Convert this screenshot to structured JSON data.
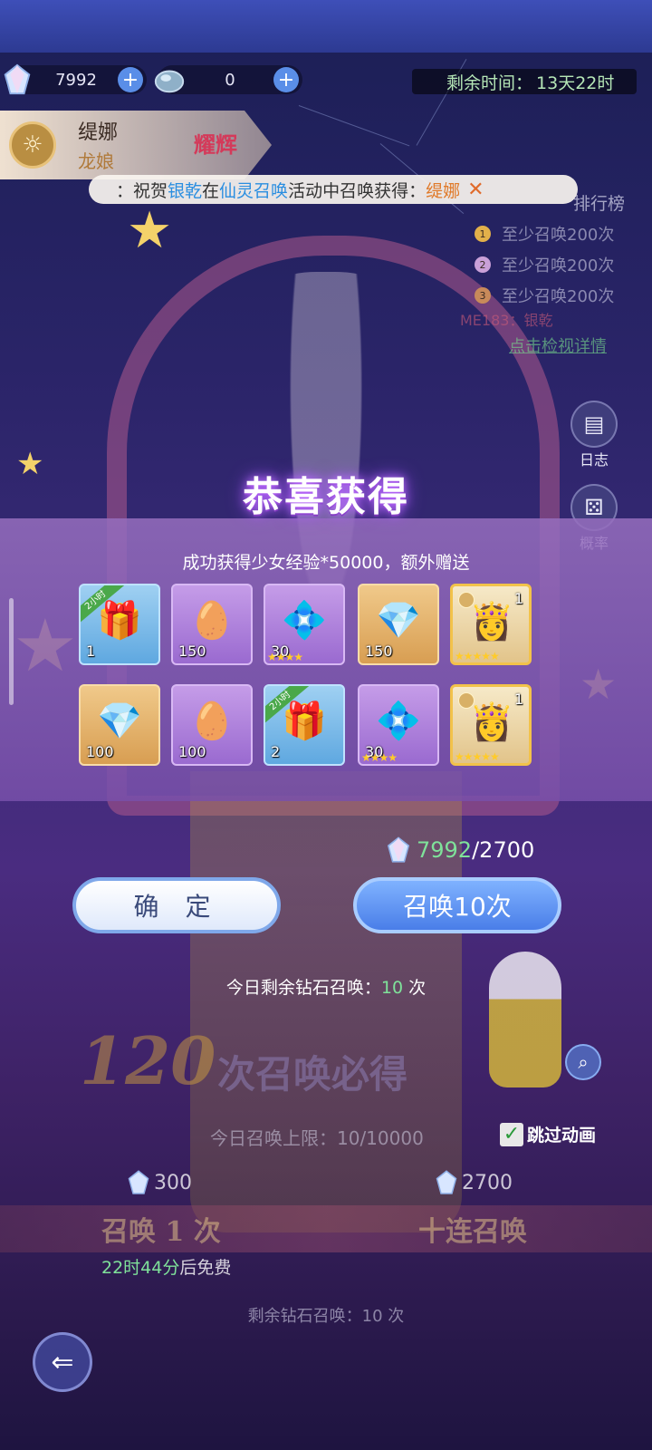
{
  "header": {
    "resources": [
      {
        "icon": "diamond-icon",
        "value": "7992"
      },
      {
        "icon": "crystal-ore-icon",
        "value": "0"
      }
    ],
    "timer_label": "剩余时间：",
    "timer_value": "13天22时"
  },
  "hero": {
    "name": "缇娜",
    "race": "龙娘",
    "rank_badge": "耀辉"
  },
  "ticker": {
    "prefix": "：祝贺",
    "player": "银乾",
    "middle": "在",
    "event": "仙灵召唤",
    "suffix": "活动中召唤获得：",
    "reward": "缇娜",
    "close": "✕"
  },
  "ranking": {
    "title": "排行榜",
    "rows": [
      {
        "num": "1",
        "text": "至少召唤200次",
        "color": "#e2b04a"
      },
      {
        "num": "2",
        "text": "至少召唤200次",
        "color": "#c9a0d8"
      },
      {
        "num": "3",
        "text": "至少召唤200次",
        "color": "#c88a5a"
      }
    ],
    "me_text": "ME183：银乾",
    "detail_link": "点击检视详情"
  },
  "side_buttons": [
    {
      "label": "日志",
      "icon": "log-icon"
    },
    {
      "label": "概率",
      "icon": "dice-icon"
    }
  ],
  "popup": {
    "title": "恭喜获得",
    "subtitle": "成功获得少女经验*50000，额外赠送",
    "items": [
      {
        "kind": "blue",
        "icon": "treasure-chest-icon",
        "glyph": "🎁",
        "count": "1",
        "tag": "2小时",
        "stars": ""
      },
      {
        "kind": "purple",
        "icon": "golden-egg-icon",
        "glyph": "🥚",
        "count": "150",
        "tag": "",
        "stars": ""
      },
      {
        "kind": "purple",
        "icon": "purple-crystal-icon",
        "glyph": "💠",
        "count": "30",
        "tag": "",
        "stars": "★★★★"
      },
      {
        "kind": "gold",
        "icon": "diamond-icon",
        "glyph": "💎",
        "count": "150",
        "tag": "",
        "stars": ""
      },
      {
        "kind": "portrait",
        "icon": "character-portrait-icon",
        "glyph": "👸",
        "count": "1",
        "tag": "",
        "stars": "★★★★★"
      },
      {
        "kind": "gold",
        "icon": "diamond-icon",
        "glyph": "💎",
        "count": "100",
        "tag": "",
        "stars": ""
      },
      {
        "kind": "purple",
        "icon": "golden-egg-icon",
        "glyph": "🥚",
        "count": "100",
        "tag": "",
        "stars": ""
      },
      {
        "kind": "blue",
        "icon": "gold-chest-icon",
        "glyph": "🎁",
        "count": "2",
        "tag": "2小时",
        "stars": ""
      },
      {
        "kind": "purple",
        "icon": "purple-crystal-icon",
        "glyph": "💠",
        "count": "30",
        "tag": "",
        "stars": "★★★★"
      },
      {
        "kind": "portrait",
        "icon": "character-portrait-icon",
        "glyph": "👸",
        "count": "1",
        "tag": "",
        "stars": "★★★★★"
      }
    ]
  },
  "cost": {
    "have": "7992",
    "sep": "/",
    "need": "2700"
  },
  "buttons": {
    "confirm": "确 定",
    "summon": "召唤10次"
  },
  "today_left": {
    "prefix": "今日剩余钻石召唤：",
    "count": "10",
    "suffix": " 次"
  },
  "guarantee": {
    "number": "120",
    "text": "次召唤必得"
  },
  "limit": {
    "text": "今日召唤上限：10/10000"
  },
  "skip": {
    "label": "跳过动画",
    "checked": "✓"
  },
  "prices": {
    "single": "300",
    "ten": "2700"
  },
  "summon_bar": {
    "single": "召唤 1 次",
    "ten": "十连召唤"
  },
  "free": {
    "time": "22时44分",
    "rest": "后免费"
  },
  "bottom_left": {
    "text": "剩余钻石召唤：10 次"
  },
  "colors": {
    "accent_green": "#7fe29a",
    "accent_blue": "#4a7ee8",
    "gold": "#f2c24a"
  }
}
